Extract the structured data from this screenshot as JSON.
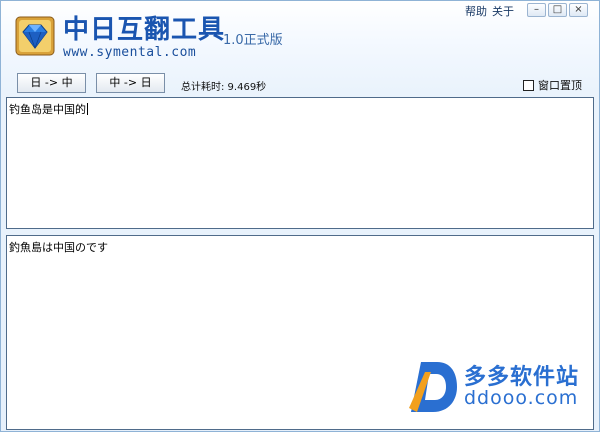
{
  "app": {
    "title": "中日互翻工具",
    "version": "1.0正式版",
    "website": "www.symental.com"
  },
  "menu": {
    "help": "帮助",
    "about": "关于"
  },
  "window_controls": {
    "minimize": "–",
    "restore": "□",
    "close": "×"
  },
  "toolbar": {
    "ja_to_zh": "日 -> 中",
    "zh_to_ja": "中 -> 日",
    "elapsed": "总计耗时: 9.469秒",
    "topmost_label": "窗口置顶",
    "topmost_checked": false
  },
  "input": {
    "text": "钓鱼岛是中国的"
  },
  "output": {
    "text": "釣魚島は中国のです"
  },
  "watermark": {
    "name": "多多软件站",
    "url": "ddooo.com"
  },
  "colors": {
    "title": "#1a55b0",
    "watermark": "#2a6fd1",
    "border": "#4f6b8a"
  }
}
